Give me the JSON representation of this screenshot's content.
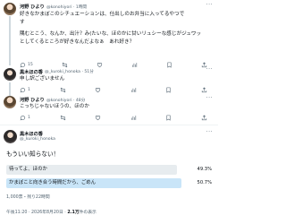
{
  "tweets": [
    {
      "name": "河野 ひより",
      "handle": "@konohiyori · 1時間",
      "lines": [
        "好きなかまぼこのシチュエーションは、仕出しのお弁当に入ってるやつで",
        "す"
      ],
      "more": "···",
      "replies": "",
      "retweets": "",
      "likes": "",
      "views": ""
    },
    {
      "name": "",
      "handle": "",
      "lines": [
        "隅むとこう、なんか、出汁？み(たいな、ほのかに甘いリュシーな感じがジュワッとしてくるところが好きなんだよなぁ　あれ好き？"
      ],
      "more": "···",
      "replies": "15",
      "retweets": "",
      "likes": "",
      "views": ""
    },
    {
      "name": "黒木ほの香",
      "handle": "@_kuroki_honoka · 51分",
      "lines": [
        "申し訳ございません"
      ],
      "more": "···",
      "replies": "1",
      "retweets": "",
      "likes": "",
      "views": ""
    },
    {
      "name": "河野 ひより",
      "handle": "@konohiyori · 48分",
      "lines": [
        "こっちじゃないほうの、ほのか"
      ],
      "more": "···",
      "replies": "1",
      "retweets": "",
      "likes": "",
      "views": ""
    }
  ],
  "main": {
    "name": "黒木ほの香",
    "handle": "@_kuroki_honoka",
    "text": "もういい知らない！",
    "more": "···"
  },
  "poll": {
    "options": [
      {
        "label": "待ってよ、ほのか",
        "percent": "49.3%",
        "fraction": 0.493
      },
      {
        "label": "かまぼこと向き合う時間だから、ごめん",
        "percent": "50.7%",
        "fraction": 0.507
      }
    ],
    "summary": "1,000票・残り22時間",
    "timestamp": "午後11:20 · 2026年8月20日 ·",
    "views_count": "2.1万",
    "views_label": "件の表示"
  },
  "colors": {
    "poll_winner": "#c9e5f8",
    "poll_other": "#e7ecef",
    "divider": "#eff3f4",
    "muted": "#536471"
  },
  "icons": {
    "reply": "reply-icon",
    "retweet": "retweet-icon",
    "like": "like-icon",
    "views": "views-icon",
    "bookmark": "bookmark-icon",
    "share": "share-icon"
  }
}
